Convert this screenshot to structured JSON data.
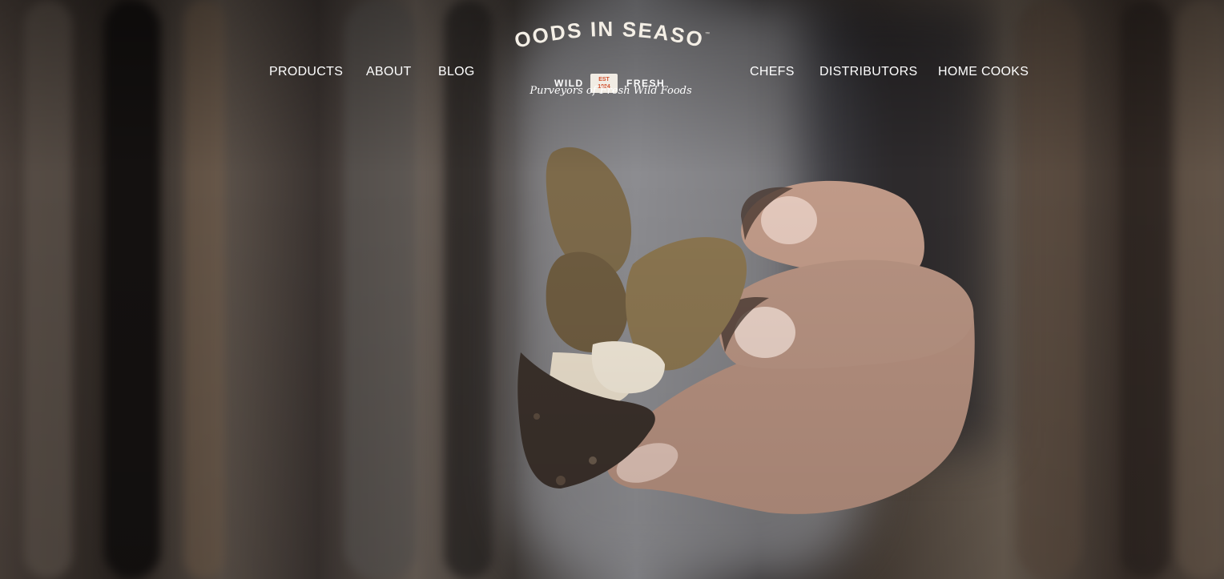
{
  "nav": {
    "left": [
      {
        "label": "PRODUCTS"
      },
      {
        "label": "ABOUT"
      },
      {
        "label": "BLOG"
      }
    ],
    "right": [
      {
        "label": "CHEFS"
      },
      {
        "label": "DISTRIBUTORS"
      },
      {
        "label": "HOME COOKS"
      }
    ]
  },
  "logo": {
    "title": "FOODS IN SEASON",
    "trademark": "™",
    "wild": "WILD",
    "fresh": "FRESH",
    "est": "EST",
    "year": "1984",
    "tagline": "Purveyors of Fresh Wild Foods"
  },
  "colors": {
    "nav_text": "#ffffff",
    "badge_bg": "#f1ece4",
    "badge_text": "#d0502e"
  },
  "hero": {
    "image": "hand-holding-morel-mushrooms"
  }
}
